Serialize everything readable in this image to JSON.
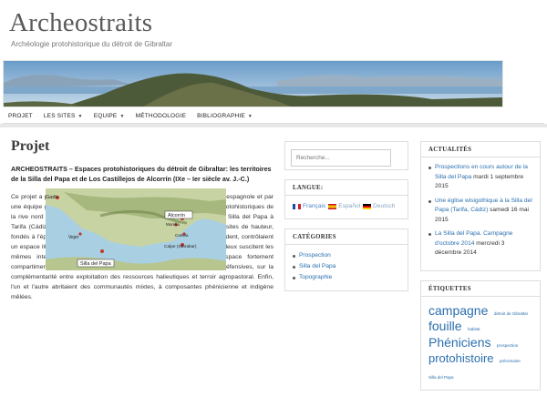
{
  "site": {
    "title": "Archeostraits",
    "description": "Archéologie protohistorique du détroit de Gibraltar"
  },
  "nav": {
    "items": [
      {
        "label": "PROJET",
        "has_caret": false
      },
      {
        "label": "LES SITES",
        "has_caret": true
      },
      {
        "label": "EQUIPE",
        "has_caret": true
      },
      {
        "label": "MÉTHODOLOGIE",
        "has_caret": false
      },
      {
        "label": "BIBLIOGRAPHIE",
        "has_caret": true
      }
    ],
    "caret_icon": "chevron-down-icon"
  },
  "content": {
    "title": "Projet",
    "lead": "ARCHEOSTRAITS – Espaces protohistoriques du détroit de Gibraltar: les territoires de la Silla del Papa et de Los Castillejos de Alcorrín (IXe – Ier siècle av. J.-C.)",
    "body": "Ce projet a pour point de départ les fouilles réalisées par une équipe franco-espagnole et par une équipe germano-espagnole sur les deux plus grandes agglomérations protohistoriques de la rive nord du détroit de Gibraltar, distantes l'une de l'autre de 40 km : La Silla del Papa à Tarifa (Cádiz) et Los Castillejos de Alcorrín à Manilva (Málaga). Ces deux sites de hauteur, fondés à l'époque des premiers établissements coloniaux phéniciens en Occident, contrôlaient un espace littoral tout en étant eux-mêmes situés en retrait de la côte. Tous deux suscitent les mêmes interrogations sur la structuration des territoires dans un espace fortement compartimenté, sur la tension entre vocation maritime et préoccupations défensives, sur la complémentarité entre exploitation des ressources halieutiques et terroir agropastoral. Enfin, l'un et l'autre abritaient des communautés mixtes, à composantes phénicienne et indigène mêlées.",
    "map_labels": {
      "gadir": "Gadir",
      "alcorrin": "Alcorrín",
      "morella": "Morella",
      "vejer": "Vejer",
      "carteia": "Carteia",
      "calpe": "Calpe (Gibraltar)",
      "silla": "Silla del Papa"
    }
  },
  "search": {
    "placeholder": "Recherche..."
  },
  "language_widget": {
    "title": "LANGUE:",
    "languages": [
      {
        "label": "Français",
        "flag": "flag-fr"
      },
      {
        "label": "Español",
        "flag": "flag-es"
      },
      {
        "label": "Deutsch",
        "flag": "flag-de"
      }
    ]
  },
  "categories_widget": {
    "title": "CATÉGORIES",
    "items": [
      "Prospection",
      "Silla del Papa",
      "Topographie"
    ]
  },
  "news_widget": {
    "title": "ACTUALITÉS",
    "items": [
      {
        "link": "Prospections en cours autour de la Silla del Papa",
        "date": "mardi 1 septembre 2015"
      },
      {
        "link": "Une église wisigothique à la Silla del Papa (Tarifa, Cádiz)",
        "date": "samedi 16 mai 2015"
      },
      {
        "link": "La Silla del Papa. Campagne d'octobre 2014",
        "date": "mercredi 3 décembre 2014"
      }
    ]
  },
  "tags_widget": {
    "title": "ÉTIQUETTES",
    "tags": [
      {
        "label": "campagne",
        "size": "xl"
      },
      {
        "label": "détroit de Gibraltar",
        "size": "sm"
      },
      {
        "label": "fouille",
        "size": "xl"
      },
      {
        "label": "habitat",
        "size": "sm"
      },
      {
        "label": "Phéniciens",
        "size": "xl"
      },
      {
        "label": "prospection",
        "size": "sm"
      },
      {
        "label": "protohistoire",
        "size": "lg"
      },
      {
        "label": "préromaine",
        "size": "sm"
      },
      {
        "label": "Silla del Papa",
        "size": "sm"
      }
    ]
  },
  "colors": {
    "link": "#2a6fae",
    "text": "#333333",
    "border": "#dddddd"
  }
}
